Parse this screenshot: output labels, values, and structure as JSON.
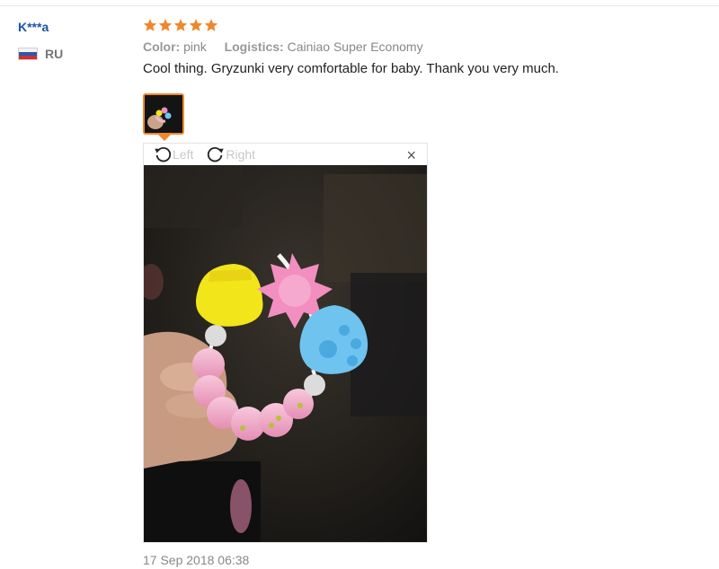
{
  "reviewer": {
    "name": "K***a",
    "country_code": "RU",
    "flag_icon": "russia-flag-icon"
  },
  "rating": {
    "stars": 5,
    "max": 5,
    "color": "#f0872c"
  },
  "meta": {
    "color_label": "Color:",
    "color_value": "pink",
    "logistics_label": "Logistics:",
    "logistics_value": "Cainiao Super Economy"
  },
  "review_text": "Cool thing. Gryzunki very comfortable for baby. Thank you very much.",
  "viewer": {
    "rotate_left_label": "Left",
    "rotate_right_label": "Right",
    "close_label": "×"
  },
  "date": "17 Sep 2018 06:38",
  "colors": {
    "link": "#1a55a8",
    "accent": "#f0872c"
  }
}
